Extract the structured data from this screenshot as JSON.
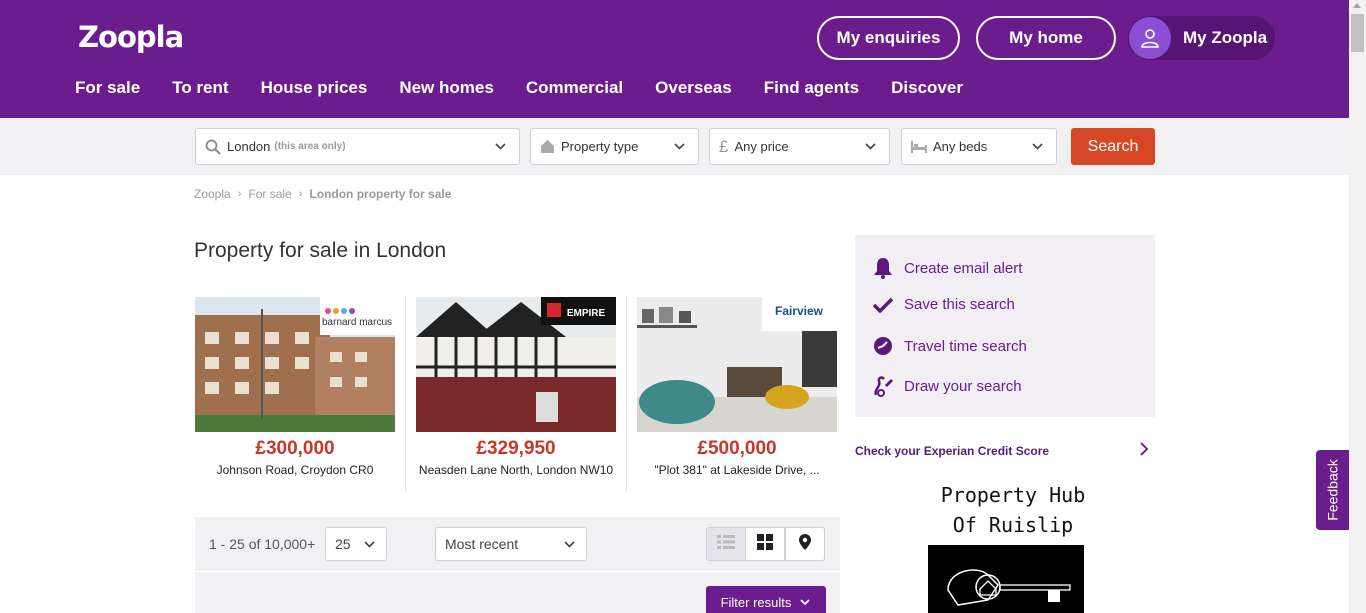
{
  "header": {
    "logo": "Zoopla",
    "my_enquiries": "My enquiries",
    "my_home": "My home",
    "my_zoopla": "My Zoopla",
    "nav": [
      "For sale",
      "To rent",
      "House prices",
      "New homes",
      "Commercial",
      "Overseas",
      "Find agents",
      "Discover"
    ]
  },
  "search": {
    "location": "London",
    "location_hint": "(this area only)",
    "property_type": "Property type",
    "price": "Any price",
    "beds": "Any beds",
    "button": "Search"
  },
  "breadcrumb": [
    "Zoopla",
    "For sale",
    "London property for sale"
  ],
  "page_title": "Property for sale in London",
  "featured": [
    {
      "price": "£300,000",
      "address": "Johnson Road, Croydon CR0",
      "agent": "barnard marcus"
    },
    {
      "price": "£329,950",
      "address": "Neasden Lane North, London NW10",
      "agent": "EMPIRE"
    },
    {
      "price": "£500,000",
      "address": "\"Plot 381\" at Lakeside Drive, ...",
      "agent": "Fairview"
    }
  ],
  "results": {
    "count": "1 - 25 of 10,000+",
    "per_page": "25",
    "sort": "Most recent",
    "filter": "Filter results"
  },
  "side": {
    "items": [
      "Create email alert",
      "Save this search",
      "Travel time search",
      "Draw your search"
    ],
    "credit": "Check your Experian Credit Score",
    "ad_title": "Property Hub Of Ruislip"
  },
  "feedback": "Feedback",
  "colors": {
    "brand": "#6b1d8e",
    "price": "#c8382a",
    "search_button": "#d84725"
  }
}
